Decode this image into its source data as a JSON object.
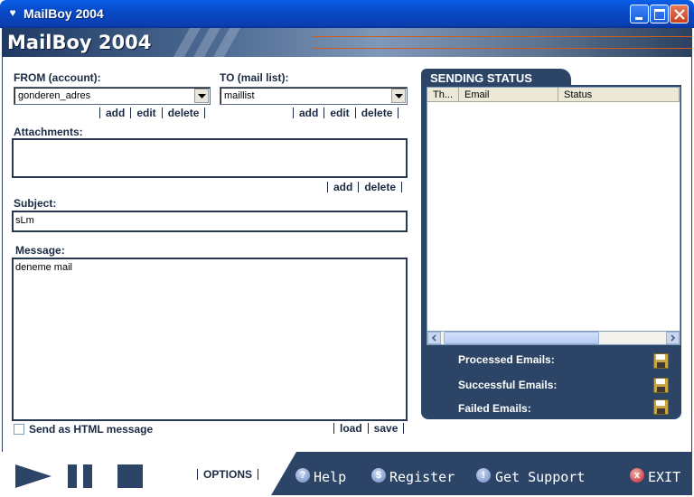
{
  "window": {
    "title": "MailBoy 2004"
  },
  "banner": {
    "logo": "MailBoy 2004"
  },
  "from": {
    "label": "FROM (account):",
    "value": "gonderen_adres",
    "links": [
      "add",
      "edit",
      "delete"
    ]
  },
  "to": {
    "label": "TO (mail list):",
    "value": "maillist",
    "links": [
      "add",
      "edit",
      "delete"
    ]
  },
  "attachments": {
    "label": "Attachments:",
    "links": [
      "add",
      "delete"
    ]
  },
  "subject": {
    "label": "Subject:",
    "value": "sLm"
  },
  "message": {
    "label": "Message:",
    "value": "deneme mail",
    "links": [
      "load",
      "save"
    ],
    "html_checkbox_label": "Send as HTML message",
    "html_checked": false
  },
  "sending_status": {
    "title": "SENDING STATUS",
    "columns": [
      "Th...",
      "Email",
      "Status"
    ],
    "rows": [],
    "processed_label": "Processed Emails:",
    "successful_label": "Successful Emails:",
    "failed_label": "Failed Emails:"
  },
  "toolbar": {
    "options_label": "OPTIONS",
    "help_label": "Help",
    "register_label": "Register",
    "support_label": "Get Support",
    "exit_label": "EXIT"
  },
  "icons": {
    "play": "play-icon",
    "pause": "pause-icon",
    "stop": "stop-icon",
    "help": "question-icon",
    "register": "dollar-icon",
    "support": "exclamation-icon",
    "exit": "x-icon",
    "save": "floppy-disk-icon"
  },
  "colors": {
    "panel": "#2c4566",
    "titlebar": "#0748c4",
    "accent_stripe": "#d05a20"
  }
}
